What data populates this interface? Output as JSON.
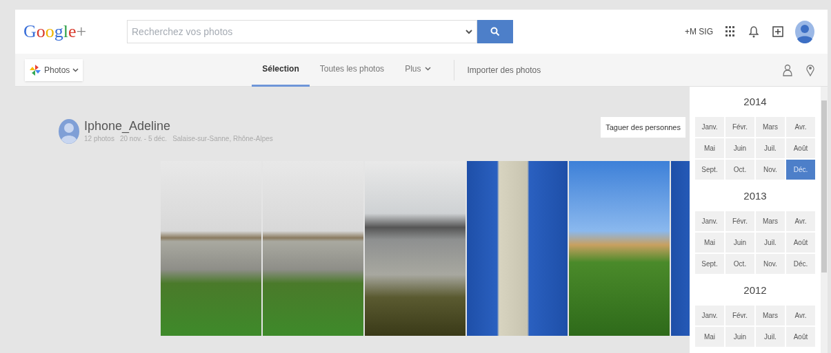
{
  "header": {
    "logo": "Google+",
    "search": {
      "placeholder": "Recherchez vos photos"
    },
    "account_link": "+M SIG"
  },
  "nav": {
    "app_menu": "Photos",
    "tabs": [
      {
        "label": "Sélection",
        "selected": true
      },
      {
        "label": "Toutes les photos",
        "selected": false
      },
      {
        "label": "Plus",
        "selected": false
      }
    ],
    "upload": "Importer des photos"
  },
  "album": {
    "title": "Iphone_Adeline",
    "photo_count": "12 photos",
    "dates": "20 nov. - 5 déc.",
    "location": "Salaise-sur-Sanne, Rhône-Alpes",
    "tag_button": "Taguer des personnes",
    "photos": [
      {
        "kind": "river"
      },
      {
        "kind": "river"
      },
      {
        "kind": "bridge"
      },
      {
        "kind": "hut"
      },
      {
        "kind": "field"
      },
      {
        "kind": "hut"
      }
    ]
  },
  "timeline": [
    {
      "year": "2014",
      "months": [
        {
          "label": "Janv.",
          "selected": false
        },
        {
          "label": "Févr.",
          "selected": false
        },
        {
          "label": "Mars",
          "selected": false
        },
        {
          "label": "Avr.",
          "selected": false
        },
        {
          "label": "Mai",
          "selected": false
        },
        {
          "label": "Juin",
          "selected": false
        },
        {
          "label": "Juil.",
          "selected": false
        },
        {
          "label": "Août",
          "selected": false
        },
        {
          "label": "Sept.",
          "selected": false
        },
        {
          "label": "Oct.",
          "selected": false
        },
        {
          "label": "Nov.",
          "selected": false
        },
        {
          "label": "Déc.",
          "selected": true
        }
      ]
    },
    {
      "year": "2013",
      "months": [
        {
          "label": "Janv.",
          "selected": false
        },
        {
          "label": "Févr.",
          "selected": false
        },
        {
          "label": "Mars",
          "selected": false
        },
        {
          "label": "Avr.",
          "selected": false
        },
        {
          "label": "Mai",
          "selected": false
        },
        {
          "label": "Juin",
          "selected": false
        },
        {
          "label": "Juil.",
          "selected": false
        },
        {
          "label": "Août",
          "selected": false
        },
        {
          "label": "Sept.",
          "selected": false
        },
        {
          "label": "Oct.",
          "selected": false
        },
        {
          "label": "Nov.",
          "selected": false
        },
        {
          "label": "Déc.",
          "selected": false
        }
      ]
    },
    {
      "year": "2012",
      "months": [
        {
          "label": "Janv.",
          "selected": false
        },
        {
          "label": "Févr.",
          "selected": false
        },
        {
          "label": "Mars",
          "selected": false
        },
        {
          "label": "Avr.",
          "selected": false
        },
        {
          "label": "Mai",
          "selected": false
        },
        {
          "label": "Juin",
          "selected": false
        },
        {
          "label": "Juil.",
          "selected": false
        },
        {
          "label": "Août",
          "selected": false
        }
      ]
    }
  ]
}
